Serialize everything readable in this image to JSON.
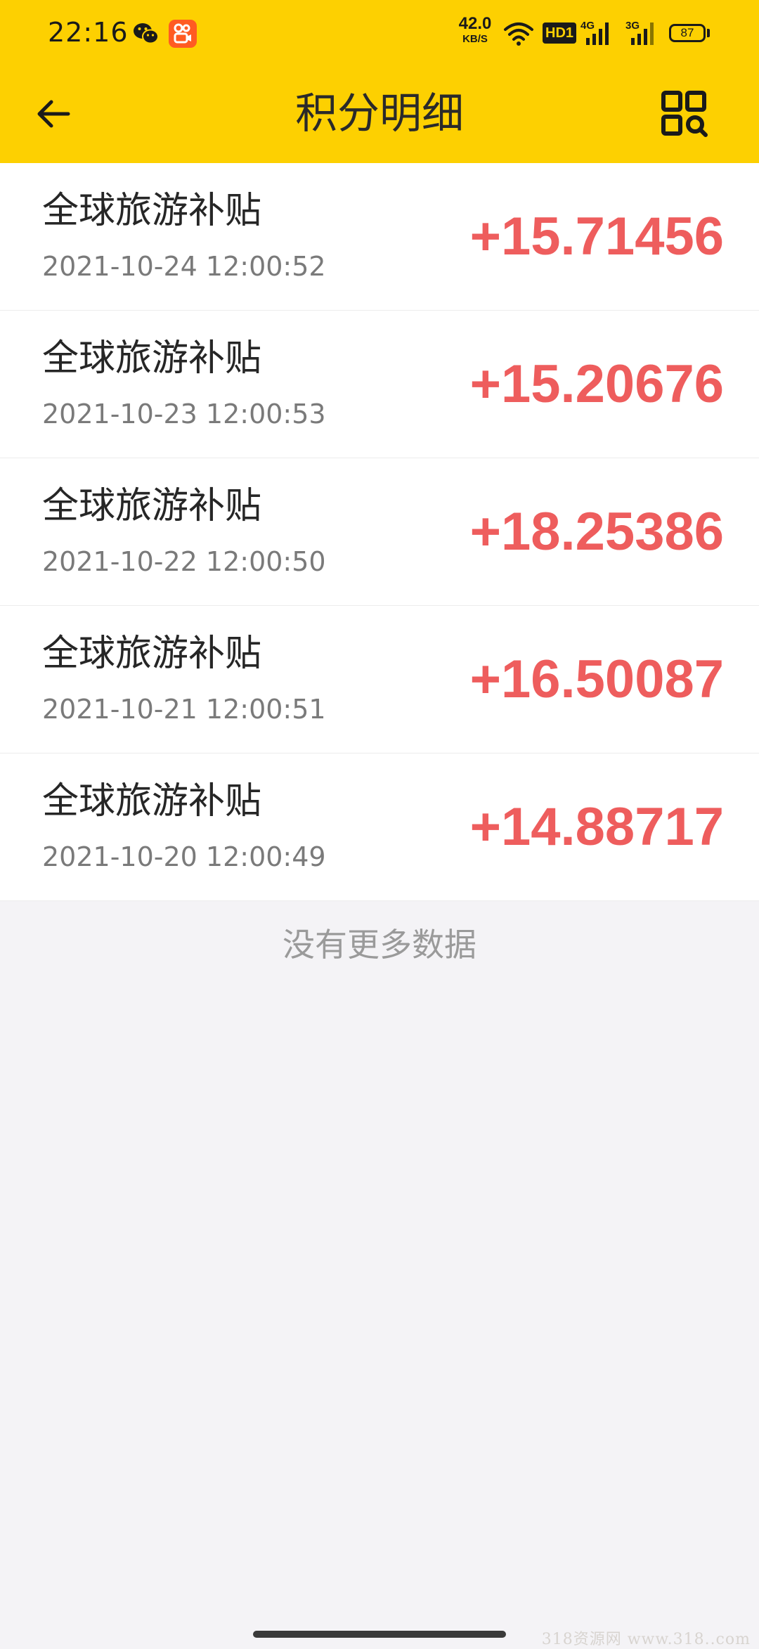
{
  "status_bar": {
    "time": "22:16",
    "net_speed_value": "42.0",
    "net_speed_unit": "KB/S",
    "hd_badge": "HD1",
    "signal_1_label": "4G",
    "signal_2_label": "3G",
    "battery": "87",
    "icons": [
      "wechat-icon",
      "kuaishou-icon",
      "wifi-icon",
      "signal-icon",
      "battery-icon"
    ]
  },
  "app_bar": {
    "title": "积分明细",
    "left_icon": "back-arrow-icon",
    "right_icon": "qr-scan-icon"
  },
  "records": [
    {
      "title": "全球旅游补贴",
      "time": "2021-10-24 12:00:52",
      "amount": "+15.71456"
    },
    {
      "title": "全球旅游补贴",
      "time": "2021-10-23 12:00:53",
      "amount": "+15.20676"
    },
    {
      "title": "全球旅游补贴",
      "time": "2021-10-22 12:00:50",
      "amount": "+18.25386"
    },
    {
      "title": "全球旅游补贴",
      "time": "2021-10-21 12:00:51",
      "amount": "+16.50087"
    },
    {
      "title": "全球旅游补贴",
      "time": "2021-10-20 12:00:49",
      "amount": "+14.88717"
    }
  ],
  "footer": {
    "no_more_text": "没有更多数据"
  },
  "watermark": "318资源网 www.318..com",
  "colors": {
    "header_bg": "#fdd001",
    "amount": "#ee5d5d",
    "page_bg": "#f4f3f6"
  }
}
